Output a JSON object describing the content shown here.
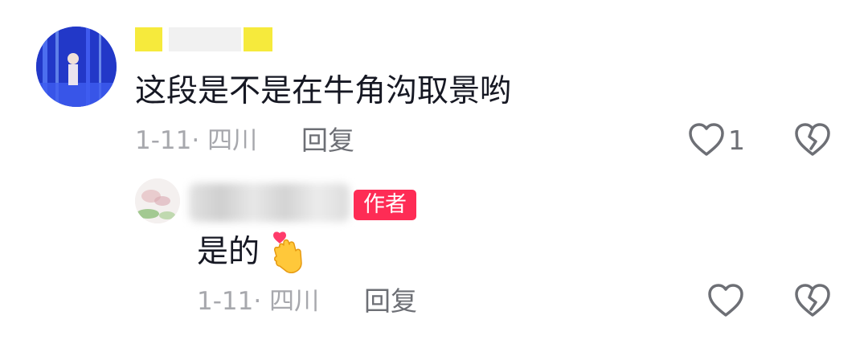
{
  "comment": {
    "text": "这段是不是在牛角沟取景哟",
    "meta": "1-11· 四川",
    "reply_label": "回复",
    "like_count": "1"
  },
  "reply": {
    "badge": "作者",
    "text": "是的",
    "meta": "1-11· 四川",
    "reply_label": "回复"
  },
  "colors": {
    "text": "#161823",
    "meta": "#a7a8ad",
    "badge": "#fe2c55",
    "icon": "#6d6f75"
  }
}
